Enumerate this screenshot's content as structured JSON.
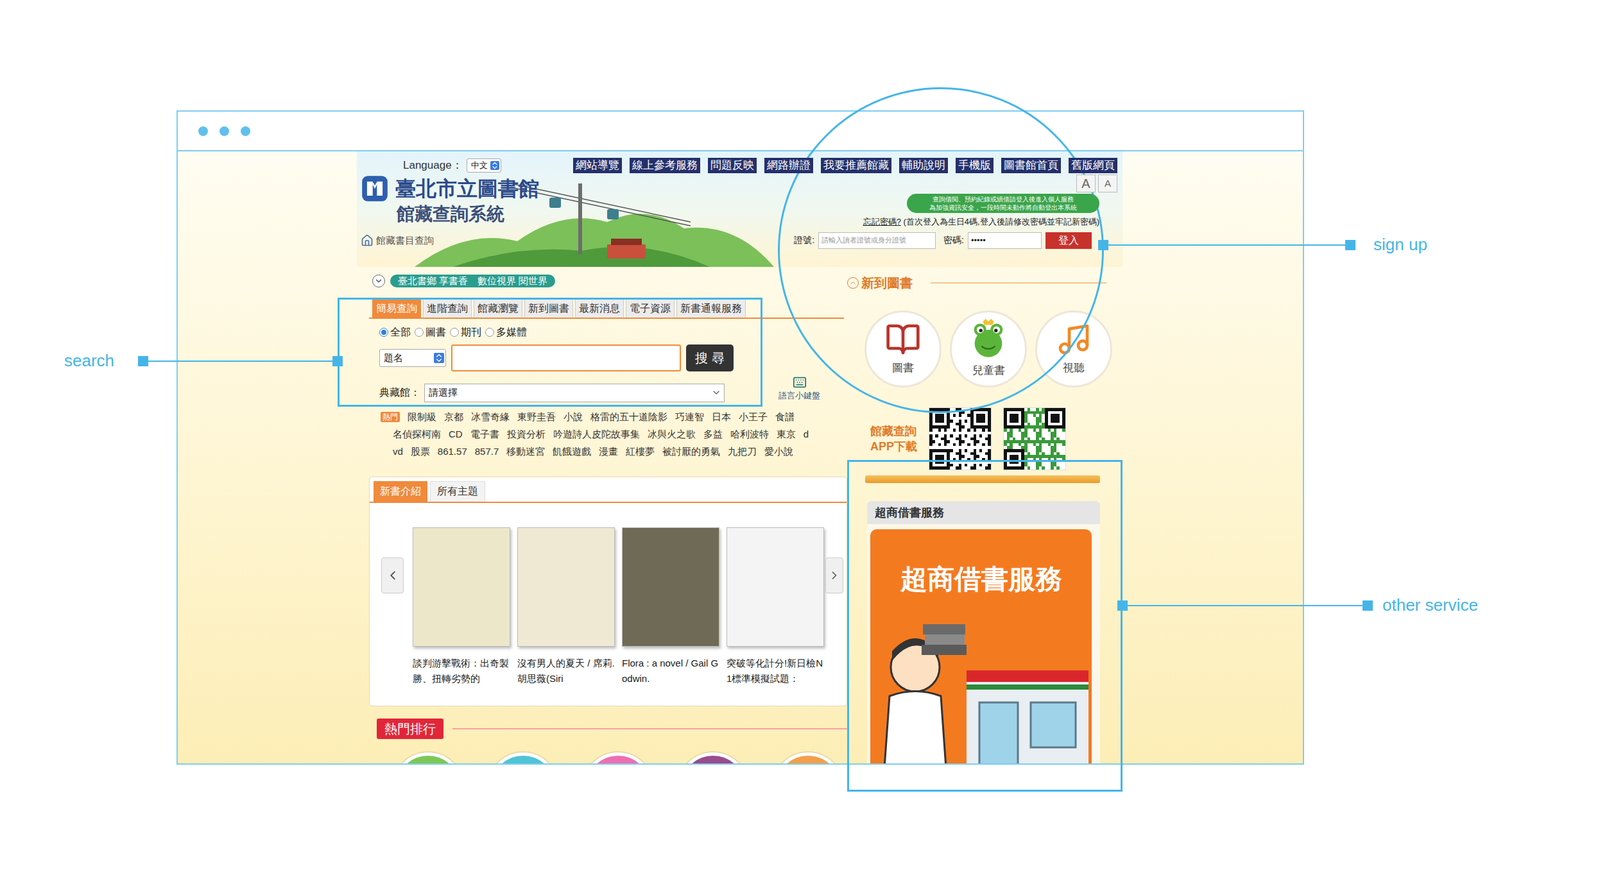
{
  "annotations": {
    "search": "search",
    "sign_up": "sign up",
    "other_service": "other service"
  },
  "header": {
    "language_label": "Language：",
    "language_value": "中文",
    "nav": [
      "網站導覽",
      "線上參考服務",
      "問題反映",
      "網路辦證",
      "我要推薦館藏",
      "輔助說明",
      "手機版",
      "圖書館首頁",
      "舊版網頁"
    ],
    "logo_title": "臺北市立圖書館",
    "logo_subtitle": "館藏查詢系統",
    "breadcrumb": "館藏書目查詢",
    "font_buttons": [
      "A",
      "A"
    ]
  },
  "login": {
    "notice": [
      "查詢借閱、預約紀錄或續借請登入後進入個人服務",
      "為加強資訊安全，一段時間未動作將自動登出本系統"
    ],
    "forgot": "忘記密碼?",
    "hint": "(首次登入為生日4碼,登入後請修改密碼並牢記新密碼)",
    "id_label": "證號:",
    "id_placeholder": "請輸入讀者證號或身分證號",
    "password_label": "密碼:",
    "password_value": "•••••",
    "button": "登入"
  },
  "slogan": "臺北書鄉 享書香　數位視界 閱世界",
  "search": {
    "tabs": [
      {
        "label": "簡易查詢",
        "selected": true
      },
      {
        "label": "進階查詢",
        "selected": false
      },
      {
        "label": "館藏瀏覽",
        "selected": false
      },
      {
        "label": "新到圖書",
        "selected": false
      },
      {
        "label": "最新消息",
        "selected": false
      },
      {
        "label": "電子資源",
        "selected": false
      },
      {
        "label": "新書通報服務",
        "selected": false
      }
    ],
    "radios": [
      {
        "label": "全部",
        "selected": true
      },
      {
        "label": "圖書",
        "selected": false
      },
      {
        "label": "期刊",
        "selected": false
      },
      {
        "label": "多媒體",
        "selected": false
      }
    ],
    "field": "題名",
    "query": "",
    "button": "搜 尋",
    "branch_label": "典藏館：",
    "branch_value": "請選擇",
    "keyboard": "語言小鍵盤"
  },
  "hot": {
    "label": "熱門",
    "rows": [
      [
        "限制級",
        "京都",
        "冰雪奇緣",
        "東野圭吾",
        "小說",
        "格雷的五十道陰影",
        "巧連智",
        "日本",
        "小王子",
        "食譜"
      ],
      [
        "名偵探柯南",
        "CD",
        "電子書",
        "投資分析",
        "吟遊詩人皮陀故事集",
        "冰與火之歌",
        "多益",
        "哈利波特",
        "東京",
        "d"
      ],
      [
        "vd",
        "股票",
        "861.57",
        "857.7",
        "移動迷宮",
        "飢餓遊戲",
        "漫畫",
        "紅樓夢",
        "被討厭的勇氣",
        "九把刀",
        "愛小說"
      ]
    ]
  },
  "new_books": {
    "tabs": [
      {
        "label": "新書介紹",
        "selected": true
      },
      {
        "label": "所有主題",
        "selected": false
      }
    ],
    "books": [
      {
        "caption": "談判游擊戰術：出奇製勝、扭轉劣勢的",
        "color": "#ece7c9"
      },
      {
        "caption": "沒有男人的夏天 / 席莉.胡思薇(Siri",
        "color": "#efe9d3"
      },
      {
        "caption": "Flora : a novel / Gail Godwin.",
        "color": "#6f6a55"
      },
      {
        "caption": "突破等化計分!新日檢N1標準模擬試題：",
        "color": "#f4f4f4"
      }
    ]
  },
  "ranking": {
    "title": "熱門排行",
    "circles": [
      {
        "color": "#7dc855"
      },
      {
        "color": "#4fc4d6"
      },
      {
        "color": "#ee6fb0"
      },
      {
        "color": "#9a4c8c"
      },
      {
        "color": "#f3a04a"
      }
    ]
  },
  "new_arrivals": {
    "title": "新到圖書",
    "items": [
      {
        "label": "圖書",
        "kind": "book"
      },
      {
        "label": "兒童書",
        "kind": "frog"
      },
      {
        "label": "視聽",
        "kind": "music"
      }
    ]
  },
  "app": {
    "label": [
      "館藏查詢",
      "APP下載"
    ]
  },
  "service": {
    "title": "超商借書服務",
    "banner": "超商借書服務"
  }
}
